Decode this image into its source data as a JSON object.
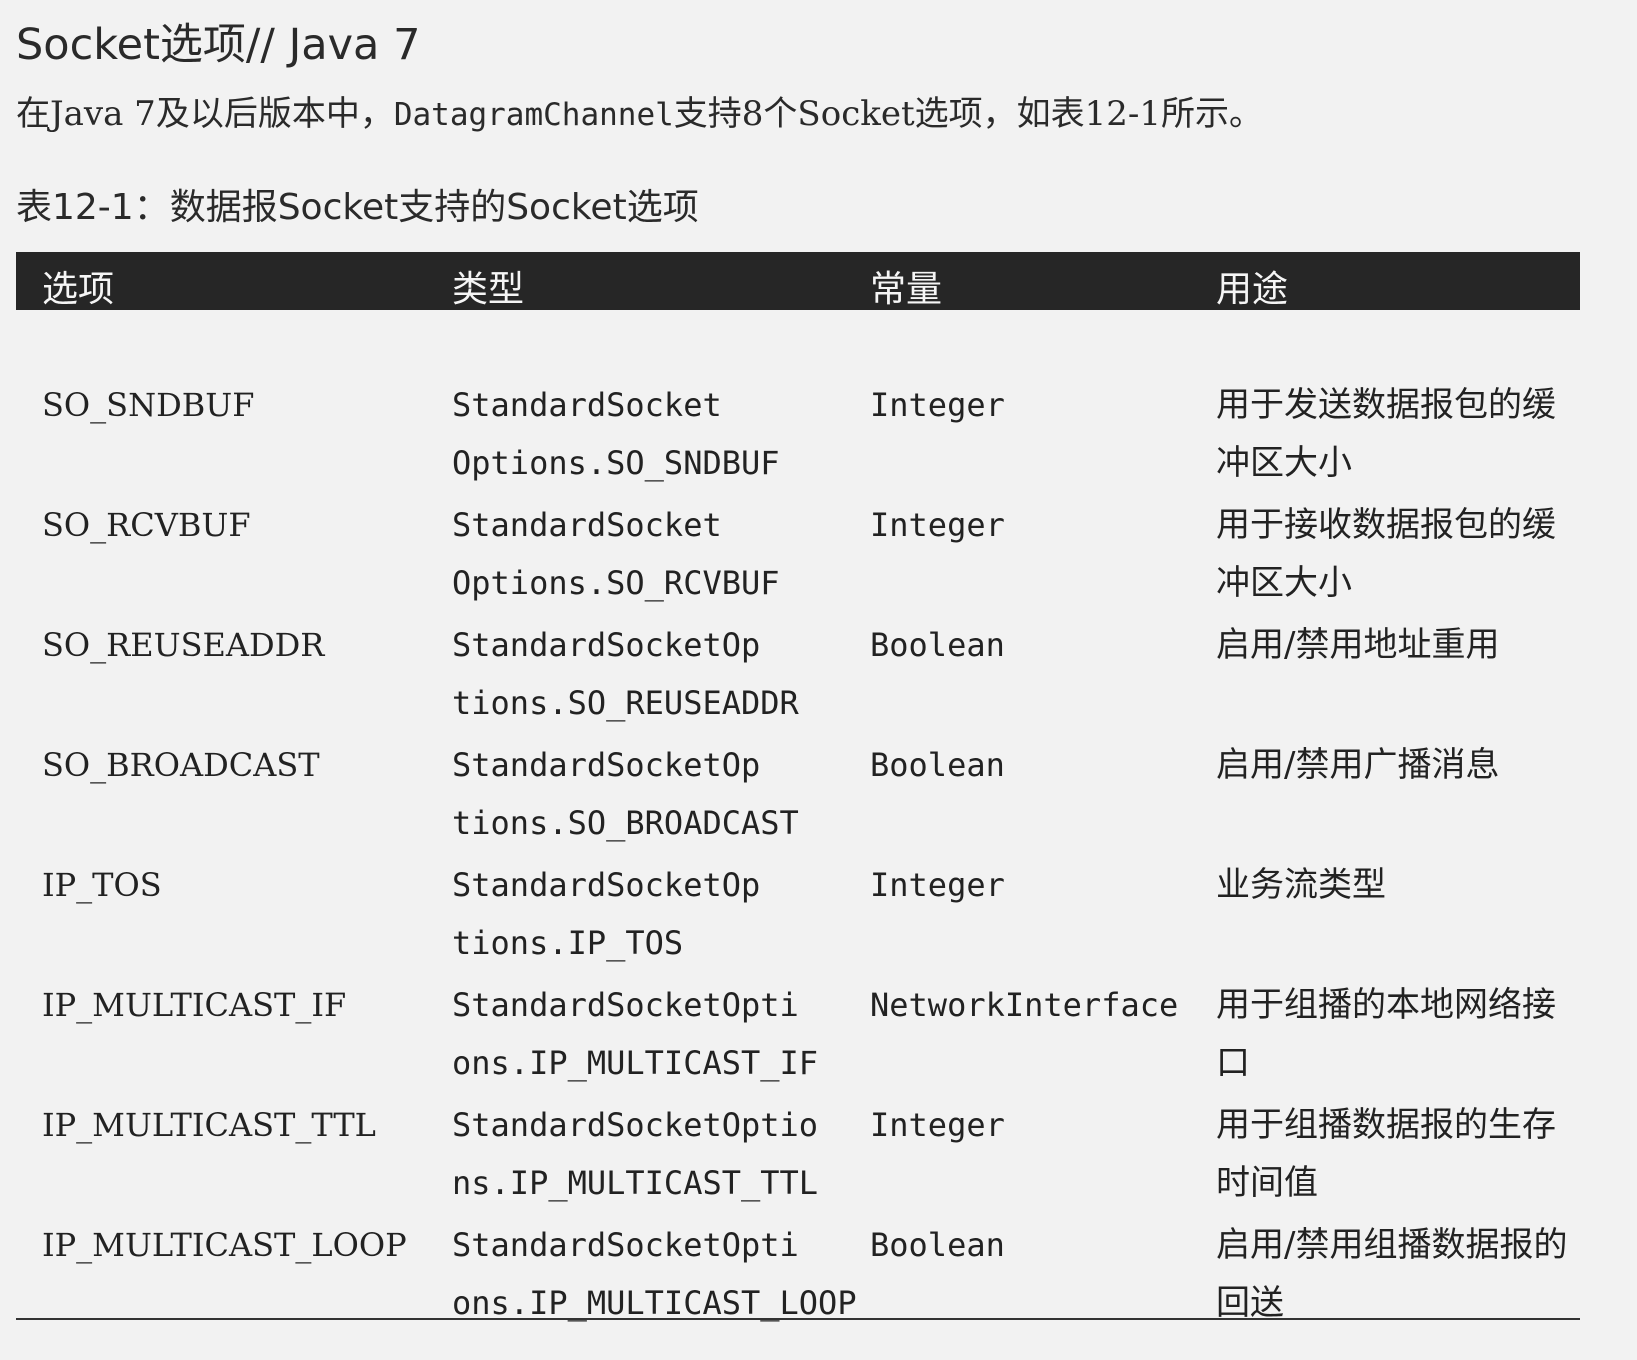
{
  "heading": "Socket选项// Java 7",
  "intro": {
    "before": "在Java 7及以后版本中，",
    "code": "DatagramChannel",
    "after": "支持8个Socket选项，如表12-1所示。"
  },
  "caption": "表12-1：数据报Socket支持的Socket选项",
  "table": {
    "headers": {
      "option": "选项",
      "type": "类型",
      "constant": "常量",
      "usage": "用途"
    },
    "rows": [
      {
        "option": "SO_SNDBUF",
        "type_line1": "StandardSocket",
        "type_line2": "Options.SO_SNDBUF",
        "constant": "Integer",
        "usage": "用于发送数据报包的缓冲区大小"
      },
      {
        "option": "SO_RCVBUF",
        "type_line1": "StandardSocket",
        "type_line2": "Options.SO_RCVBUF",
        "constant": "Integer",
        "usage": "用于接收数据报包的缓冲区大小"
      },
      {
        "option": "SO_REUSEADDR",
        "type_line1": "StandardSocketOp",
        "type_line2": "tions.SO_REUSEADDR",
        "constant": "Boolean",
        "usage": "启用/禁用地址重用"
      },
      {
        "option": "SO_BROADCAST",
        "type_line1": "StandardSocketOp",
        "type_line2": "tions.SO_BROADCAST",
        "constant": "Boolean",
        "usage": "启用/禁用广播消息"
      },
      {
        "option": "IP_TOS",
        "type_line1": "StandardSocketOp",
        "type_line2": "tions.IP_TOS",
        "constant": "Integer",
        "usage": "业务流类型"
      },
      {
        "option": "IP_MULTICAST_IF",
        "type_line1": "StandardSocketOpti",
        "type_line2": "ons.IP_MULTICAST_IF",
        "constant": "NetworkInterface",
        "usage": "用于组播的本地网络接口"
      },
      {
        "option": "IP_MULTICAST_TTL",
        "type_line1": "StandardSocketOptio",
        "type_line2": "ns.IP_MULTICAST_TTL",
        "constant": "Integer",
        "usage": "用于组播数据报的生存时间值"
      },
      {
        "option": "IP_MULTICAST_LOOP",
        "type_line1": "StandardSocketOpti",
        "type_line2": "ons.IP_MULTICAST_LOOP",
        "constant": "Boolean",
        "usage": "启用/禁用组播数据报的回送"
      }
    ]
  }
}
